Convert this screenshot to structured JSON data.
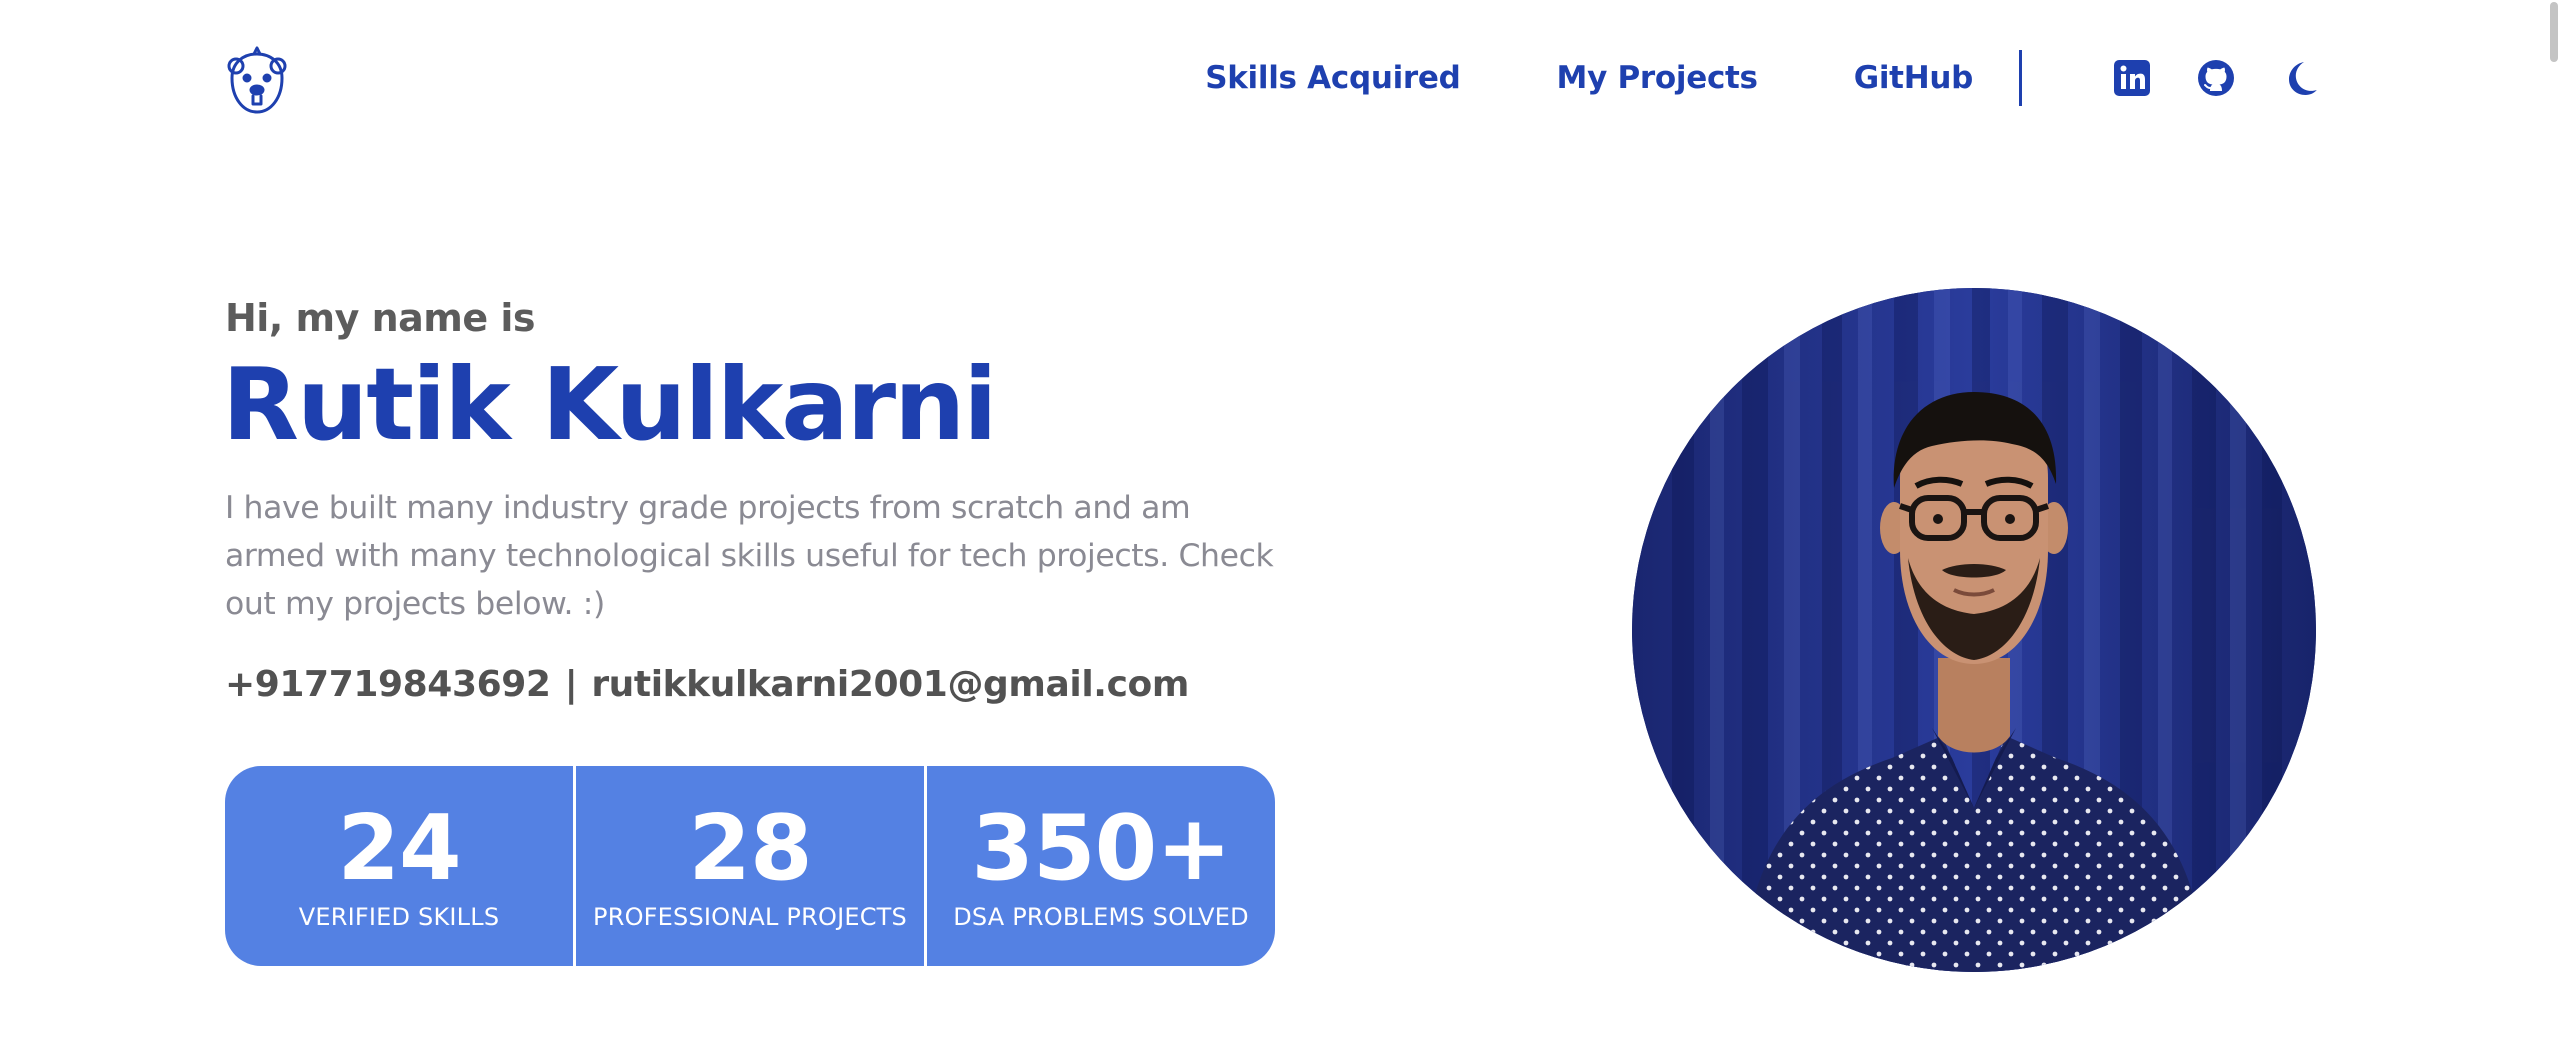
{
  "colors": {
    "brand": "#1e40af",
    "stats_bg": "#5481e3",
    "muted_text": "#8a8a93",
    "dark_text": "#5c5c5c"
  },
  "nav": {
    "logo_icon": "bear-logo-icon",
    "links": [
      {
        "label": "Skills Acquired"
      },
      {
        "label": "My Projects"
      },
      {
        "label": "GitHub"
      }
    ],
    "icons": [
      "linkedin-icon",
      "github-icon",
      "moon-icon"
    ]
  },
  "hero": {
    "greeting": "Hi, my name is",
    "name": "Rutik Kulkarni",
    "bio": "I have built many industry grade projects from scratch and am armed with many technological skills useful for tech projects. Check out my projects below. :)",
    "phone": "+917719843692",
    "separator": "|",
    "email": "rutikkulkarni2001@gmail.com"
  },
  "stats": [
    {
      "value": "24",
      "label": "VERIFIED SKILLS"
    },
    {
      "value": "28",
      "label": "PROFESSIONAL PROJECTS"
    },
    {
      "value": "350+",
      "label": "DSA PROBLEMS SOLVED"
    }
  ],
  "portrait": {
    "shape": "circle",
    "subject": "profile-photo"
  }
}
